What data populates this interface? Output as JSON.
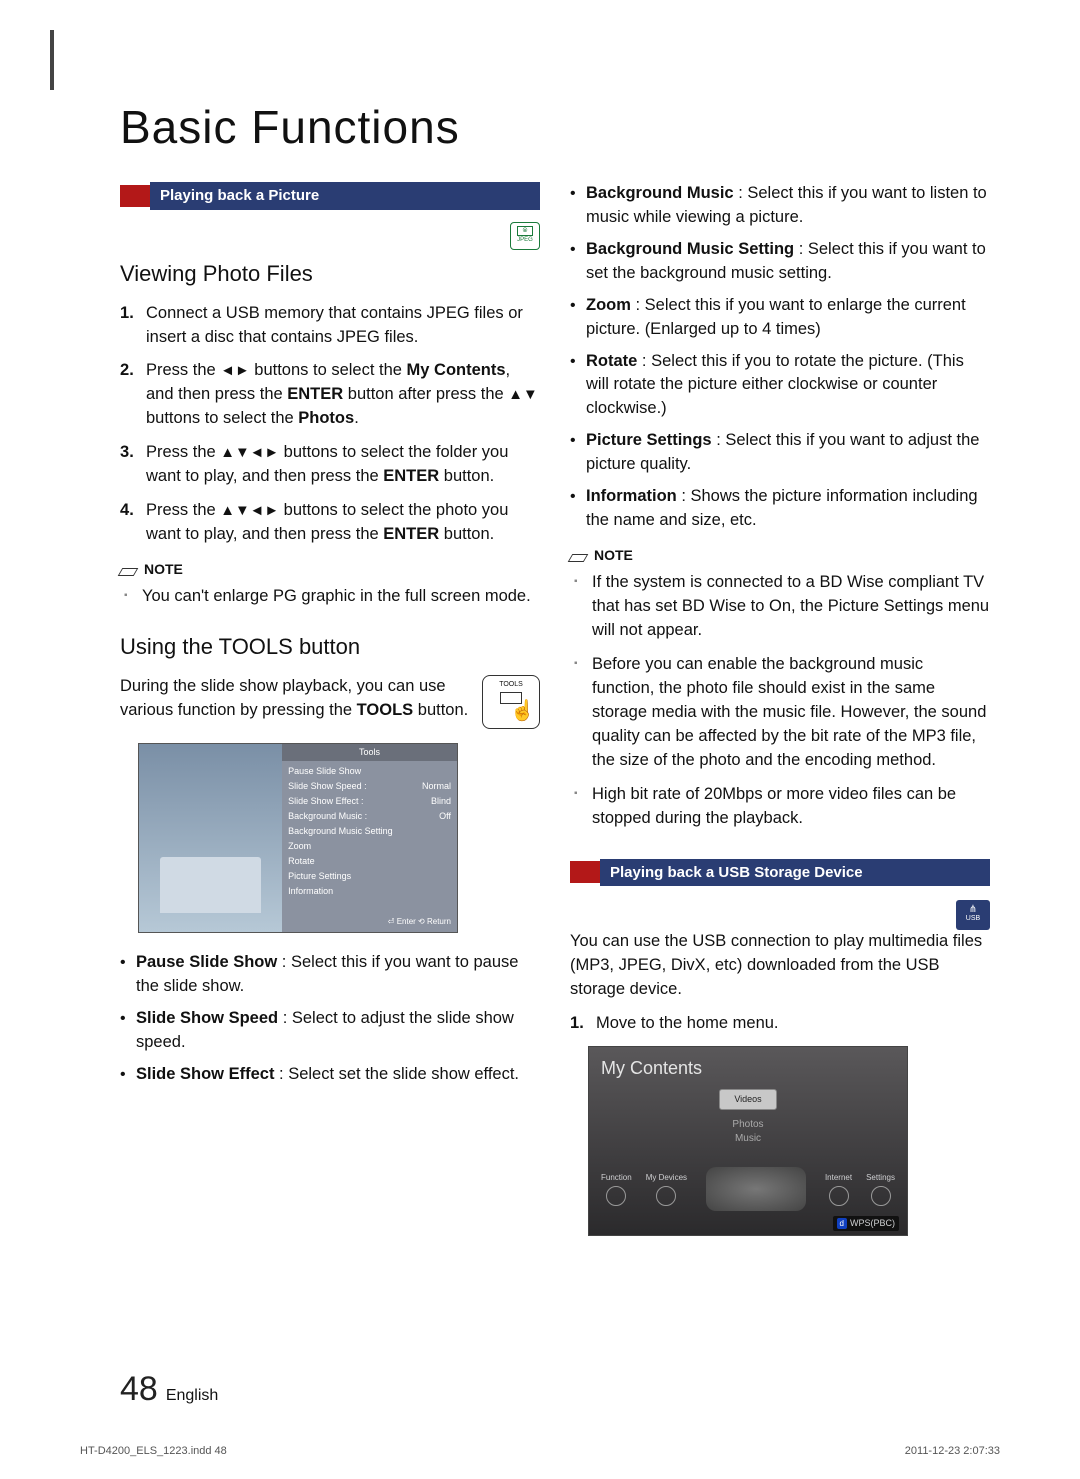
{
  "page": {
    "title": "Basic Functions",
    "page_number": "48",
    "language": "English",
    "footer_file": "HT-D4200_ELS_1223.indd   48",
    "footer_date": "2011-12-23   2:07:33"
  },
  "left": {
    "ribbon1": "Playing back a Picture",
    "jpeg_label": "JPEG",
    "heading_view": "Viewing Photo Files",
    "steps": [
      {
        "pre": "Connect a USB memory that contains JPEG files or insert a disc that contains JPEG files."
      },
      {
        "a": "Press the ",
        "b": "◄►",
        "c": " buttons to select the ",
        "d": "My Contents",
        "e": ", and then press the ",
        "f": "ENTER",
        "g": " button after press the ",
        "h": "▲▼",
        "i": " buttons to select the ",
        "j": "Photos",
        "k": "."
      },
      {
        "a": "Press the ",
        "b": "▲▼◄►",
        "c": " buttons to select the folder you want to play, and then press the ",
        "d": "ENTER",
        "e": " button."
      },
      {
        "a": "Press the ",
        "b": "▲▼◄►",
        "c": " buttons to select the photo you want to play, and then press the ",
        "d": "ENTER",
        "e": " button."
      }
    ],
    "note_label": "NOTE",
    "note_items": [
      "You can't enlarge PG graphic in the full screen mode."
    ],
    "heading_tools": "Using the TOOLS button",
    "tools_para_a": "During the slide show playback, you can use various function by pressing the ",
    "tools_para_b": "TOOLS",
    "tools_para_c": " button.",
    "tools_badge": "TOOLS",
    "tools_menu": {
      "title": "Tools",
      "rows": [
        {
          "l": "Pause Slide Show",
          "r": ""
        },
        {
          "l": "Slide Show Speed",
          "s": ":",
          "r": "Normal"
        },
        {
          "l": "Slide Show Effect",
          "s": ":",
          "r": "Blind"
        },
        {
          "l": "Background Music",
          "s": ":",
          "r": "Off"
        },
        {
          "l": "Background Music Setting",
          "r": ""
        },
        {
          "l": "Zoom",
          "r": ""
        },
        {
          "l": "Rotate",
          "r": ""
        },
        {
          "l": "Picture Settings",
          "r": ""
        },
        {
          "l": "Information",
          "r": ""
        }
      ],
      "footer": "⏎ Enter   ⟲ Return"
    },
    "bullets": [
      {
        "t": "Pause Slide Show",
        "d": " : Select this if you want to pause the slide show."
      },
      {
        "t": "Slide Show Speed",
        "d": " : Select to adjust the slide show speed."
      },
      {
        "t": "Slide Show Effect",
        "d": " : Select set the slide show effect."
      }
    ]
  },
  "right": {
    "bullets": [
      {
        "t": "Background Music",
        "d": " : Select this if you want to listen to music while viewing a picture."
      },
      {
        "t": "Background Music Setting",
        "d": " : Select this if you want to set the background music setting."
      },
      {
        "t": "Zoom",
        "d": " : Select this if you want to enlarge the current picture. (Enlarged up to 4 times)"
      },
      {
        "t": "Rotate",
        "d": " : Select this if you to rotate the picture. (This will rotate the picture either clockwise or counter clockwise.)"
      },
      {
        "t": "Picture Settings",
        "d": " : Select this if you want to adjust the picture quality."
      },
      {
        "t": "Information",
        "d": " : Shows the picture information including the name and size, etc."
      }
    ],
    "note_label": "NOTE",
    "note_items": [
      "If the system is connected to a BD Wise compliant TV that has set BD Wise to On, the Picture Settings menu will not appear.",
      "Before you can enable the background music function, the photo file should exist in the same storage media with the music file. However, the sound quality can be affected by the bit rate of the MP3 file, the size of the photo and the encoding method.",
      "High bit rate of 20Mbps or more video files can be stopped during the playback."
    ],
    "ribbon2": "Playing back a USB Storage Device",
    "usb_label": "USB",
    "usb_para": "You can use the USB connection to play multimedia files (MP3, JPEG, DivX, etc) downloaded from the USB storage device.",
    "step1_a": "Move to the home menu.",
    "mycontents": {
      "title": "My Contents",
      "tab_sel": "Videos",
      "opt1": "Photos",
      "opt2": "Music",
      "bi1": "Function",
      "bi2": "My Devices",
      "bi3": "Internet",
      "bi4": "Settings",
      "wps": "WPS(PBC)",
      "d": "d"
    }
  }
}
